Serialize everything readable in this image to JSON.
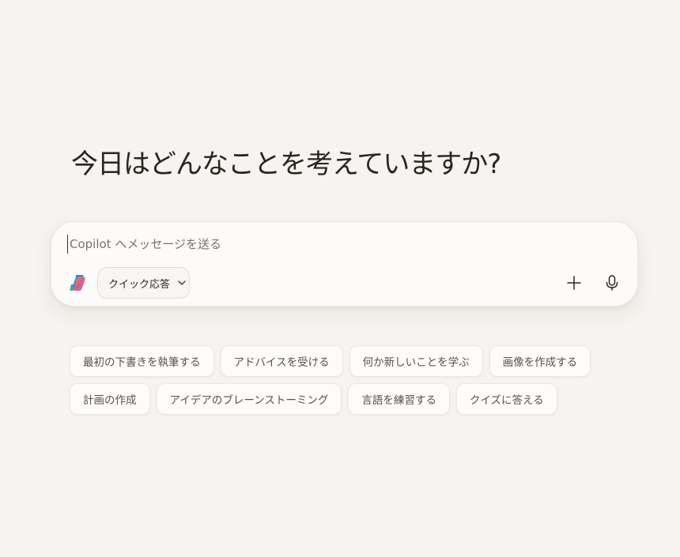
{
  "headline": "今日はどんなことを考えていますか?",
  "composer": {
    "placeholder": "Copilot へメッセージを送る",
    "value": "",
    "mode_label": "クイック応答",
    "mode_icon": "chevron-down-icon",
    "logo_icon": "copilot-logo-icon",
    "add_icon": "plus-icon",
    "mic_icon": "microphone-icon"
  },
  "suggestions": {
    "row1": [
      {
        "label": "最初の下書きを執筆する"
      },
      {
        "label": "アドバイスを受ける"
      },
      {
        "label": "何か新しいことを学ぶ"
      },
      {
        "label": "画像を作成する"
      }
    ],
    "row2": [
      {
        "label": "計画の作成"
      },
      {
        "label": "アイデアのブレーンストーミング"
      },
      {
        "label": "言語を練習する"
      },
      {
        "label": "クイズに答える"
      }
    ]
  },
  "colors": {
    "background": "#f6f3f0",
    "composer_bg": "#fcfbf9",
    "chip_text": "#5a5048",
    "placeholder": "#7a726b"
  }
}
